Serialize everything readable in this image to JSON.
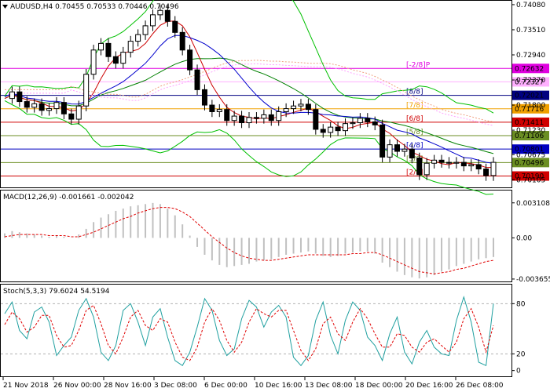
{
  "panels": {
    "main_title": "AUDUSD,H4  0.70455 0.70533 0.70446 0.70496",
    "macd_title": "MACD(12,26,9) -0.001661 -0.002042",
    "stoch_title": "Stoch(5,3,3) 79.6024 54.5194"
  },
  "chart_data": [
    {
      "type": "candlestick",
      "symbol": "AUDUSD",
      "timeframe": "H4",
      "ohlc_last": [
        0.70455,
        0.70533,
        0.70446,
        0.70496
      ],
      "y_ticks": [
        "0.74080",
        "0.73510",
        "0.72940",
        "0.72370",
        "0.71800",
        "0.71230",
        "0.70675",
        "0.70105"
      ],
      "ylim": [
        0.6995,
        0.7415
      ],
      "x_ticks": [
        "21 Nov 2018",
        "26 Nov 00:00",
        "28 Nov 16:00",
        "3 Dec 08:00",
        "6 Dec 00:00",
        "10 Dec 16:00",
        "13 Dec 08:00",
        "18 Dec 00:00",
        "20 Dec 16:00",
        "26 Dec 08:00"
      ],
      "close_path": [
        0.7195,
        0.721,
        0.7188,
        0.7175,
        0.7183,
        0.7168,
        0.7172,
        0.7186,
        0.716,
        0.7148,
        0.7178,
        0.725,
        0.7305,
        0.732,
        0.729,
        0.7275,
        0.73,
        0.7325,
        0.734,
        0.736,
        0.7385,
        0.7395,
        0.737,
        0.7345,
        0.7305,
        0.726,
        0.7215,
        0.718,
        0.7165,
        0.717,
        0.7145,
        0.7155,
        0.714,
        0.7152,
        0.715,
        0.7158,
        0.7145,
        0.7165,
        0.7172,
        0.7178,
        0.7182,
        0.717,
        0.7125,
        0.7118,
        0.713,
        0.7122,
        0.7138,
        0.714,
        0.715,
        0.7142,
        0.7135,
        0.7062,
        0.709,
        0.7075,
        0.708,
        0.706,
        0.7022,
        0.7048,
        0.7055,
        0.705,
        0.7048,
        0.705,
        0.7042,
        0.7045,
        0.7035,
        0.702,
        0.705
      ],
      "murrey_lines": [
        {
          "label": "[-2/8]P",
          "value": 0.72632,
          "color": "#e000e0",
          "price_label": "0.72632"
        },
        {
          "label": "",
          "value": 0.72327,
          "color": "#ffb0ff",
          "price_label": "0.72327"
        },
        {
          "label": "[8/8]",
          "value": 0.72021,
          "color": "#000080",
          "price_label": "0.72021"
        },
        {
          "label": "[7/8]",
          "value": 0.71716,
          "color": "#f0a000",
          "price_label": "0.71716"
        },
        {
          "label": "[6/8]",
          "value": 0.71411,
          "color": "#d00000",
          "price_label": "0.71411"
        },
        {
          "label": "[5/8]",
          "value": 0.71106,
          "color": "#6b8e23",
          "price_label": "0.71106"
        },
        {
          "label": "[4/8]",
          "value": 0.70801,
          "color": "#0000c0",
          "price_label": "0.70801"
        },
        {
          "label": "[3/8]",
          "value": 0.70496,
          "color": "#6b8e23",
          "price_label": "0.70496"
        },
        {
          "label": "[2/8]",
          "value": 0.7019,
          "color": "#d00000",
          "price_label": "0.70190"
        }
      ]
    },
    {
      "type": "histogram",
      "name": "MACD(12,26,9)",
      "main_value": -0.001661,
      "signal_value": -0.002042,
      "y_ticks": [
        "0.003108",
        "0.00",
        "-0.003655"
      ],
      "ylim": [
        -0.0038,
        0.0033
      ],
      "histogram": [
        0.0004,
        0.0006,
        0.0005,
        0.0004,
        0.0003,
        0.0002,
        0.0001,
        0.0002,
        0.0001,
        0.0,
        0.0003,
        0.0008,
        0.0014,
        0.0018,
        0.0021,
        0.0024,
        0.0026,
        0.0028,
        0.0029,
        0.003,
        0.0031,
        0.003,
        0.0026,
        0.002,
        0.0012,
        0.0002,
        -0.0008,
        -0.0015,
        -0.002,
        -0.0024,
        -0.0026,
        -0.0025,
        -0.0024,
        -0.0023,
        -0.0021,
        -0.002,
        -0.0019,
        -0.0017,
        -0.0015,
        -0.0014,
        -0.0013,
        -0.0012,
        -0.0014,
        -0.0016,
        -0.0017,
        -0.0016,
        -0.0014,
        -0.0013,
        -0.0012,
        -0.0012,
        -0.0014,
        -0.0022,
        -0.0026,
        -0.003,
        -0.0033,
        -0.0035,
        -0.0036,
        -0.0035,
        -0.0033,
        -0.003,
        -0.0028,
        -0.0025,
        -0.0023,
        -0.0021,
        -0.0019,
        -0.0018,
        -0.0017
      ],
      "signal": [
        0.0001,
        0.0002,
        0.0003,
        0.0003,
        0.0003,
        0.0003,
        0.0002,
        0.0002,
        0.0002,
        0.0001,
        0.0001,
        0.0003,
        0.0005,
        0.0008,
        0.0011,
        0.0014,
        0.0017,
        0.0019,
        0.0022,
        0.0024,
        0.0026,
        0.0027,
        0.0027,
        0.0026,
        0.0023,
        0.0019,
        0.0013,
        0.0007,
        0.0001,
        -0.0004,
        -0.0009,
        -0.0013,
        -0.0016,
        -0.0018,
        -0.0019,
        -0.002,
        -0.002,
        -0.0019,
        -0.0018,
        -0.0017,
        -0.0016,
        -0.0015,
        -0.0015,
        -0.0015,
        -0.0015,
        -0.0015,
        -0.0015,
        -0.0014,
        -0.0014,
        -0.0013,
        -0.0013,
        -0.0015,
        -0.0018,
        -0.0021,
        -0.0024,
        -0.0027,
        -0.003,
        -0.0031,
        -0.0032,
        -0.0031,
        -0.003,
        -0.0028,
        -0.0027,
        -0.0025,
        -0.0023,
        -0.0021,
        -0.002
      ]
    },
    {
      "type": "line",
      "name": "Stoch(5,3,3)",
      "main_value": 79.6024,
      "signal_value": 54.5194,
      "y_ticks": [
        "80",
        "20",
        "0"
      ],
      "ylim": [
        -5,
        100
      ],
      "levels": [
        80,
        20
      ],
      "main": [
        68,
        82,
        48,
        38,
        70,
        76,
        58,
        18,
        30,
        40,
        72,
        86,
        64,
        22,
        12,
        30,
        72,
        80,
        58,
        30,
        64,
        74,
        40,
        12,
        6,
        22,
        52,
        86,
        72,
        36,
        18,
        26,
        62,
        84,
        76,
        52,
        70,
        78,
        64,
        16,
        6,
        18,
        60,
        82,
        42,
        20,
        60,
        82,
        72,
        40,
        30,
        12,
        44,
        64,
        22,
        8,
        34,
        48,
        28,
        20,
        18,
        60,
        88,
        58,
        10,
        6,
        80
      ],
      "signal": [
        55,
        70,
        62,
        46,
        52,
        66,
        66,
        42,
        28,
        30,
        48,
        72,
        78,
        56,
        30,
        20,
        40,
        64,
        72,
        54,
        48,
        62,
        58,
        34,
        16,
        12,
        28,
        58,
        74,
        60,
        36,
        22,
        34,
        58,
        74,
        68,
        64,
        72,
        72,
        48,
        24,
        12,
        26,
        56,
        64,
        44,
        36,
        58,
        74,
        62,
        44,
        28,
        28,
        44,
        42,
        28,
        22,
        34,
        38,
        30,
        22,
        34,
        62,
        74,
        52,
        22,
        54
      ]
    }
  ]
}
